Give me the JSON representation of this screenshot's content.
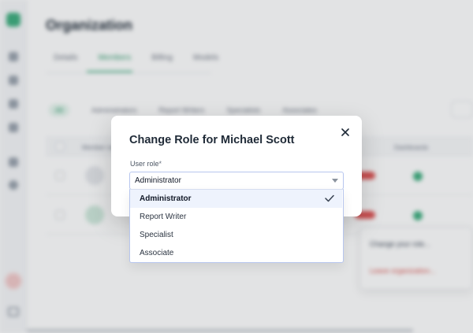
{
  "background": {
    "page_title": "Organization",
    "tabs": [
      "Details",
      "Members",
      "Billing",
      "Models"
    ],
    "active_tab": "Members",
    "filter_pills": [
      "All",
      "Administrators",
      "Report Writers",
      "Specialists",
      "Associates"
    ],
    "table_headers": [
      "Member name",
      "Dashboards"
    ],
    "row_menu": {
      "change_role": "Change your role...",
      "leave": "Leave organization..."
    }
  },
  "modal": {
    "title": "Change Role for Michael Scott",
    "field_label": "User role",
    "required_marker": "*",
    "selected_value": "Administrator",
    "options": [
      "Administrator",
      "Report Writer",
      "Specialist",
      "Associate"
    ],
    "selected_index": 0,
    "close_icon": "close-icon",
    "check_icon": "check-icon",
    "caret_icon": "caret-down-icon"
  },
  "colors": {
    "accent": "#3fae7f",
    "select_border": "#b7c6ee",
    "selected_option_bg": "#eef3fd",
    "danger": "#e05252"
  }
}
